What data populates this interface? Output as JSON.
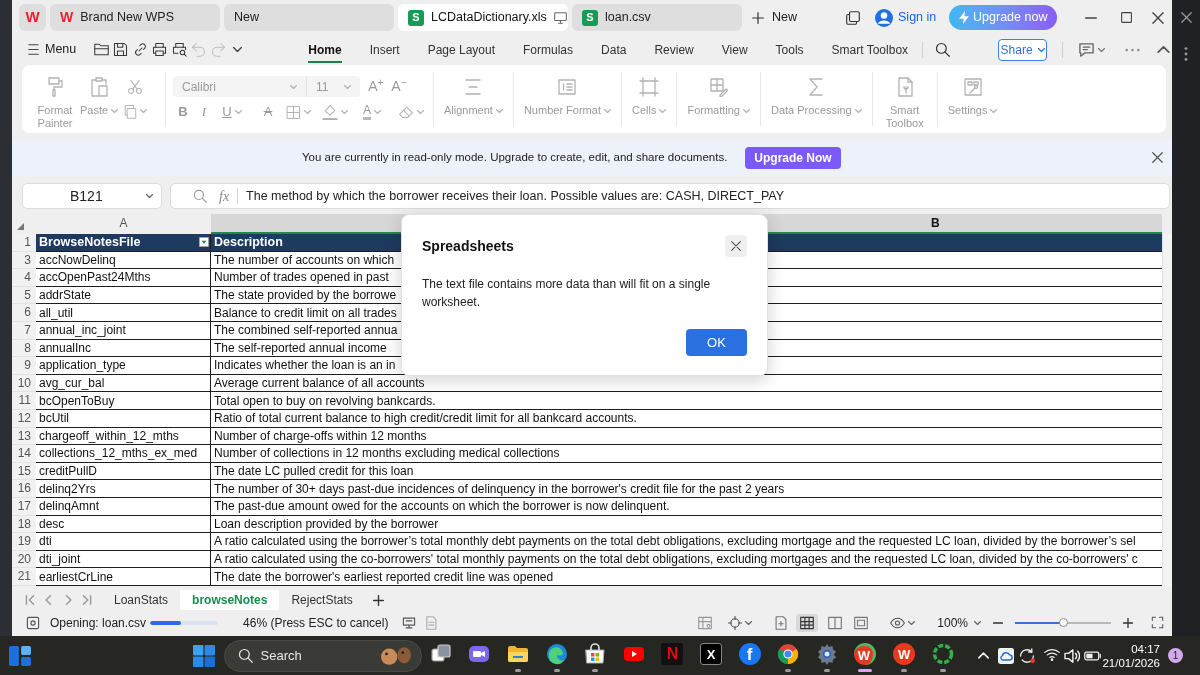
{
  "title_bar": {
    "logo": "W",
    "tabs": [
      {
        "label": "Brand New WPS",
        "kind": "home",
        "icon": "W",
        "selected": false
      },
      {
        "label": "New",
        "kind": "blank",
        "selected": false
      },
      {
        "label": "LCDataDictionary.xls",
        "kind": "sheet",
        "icon": "S",
        "selected": true
      },
      {
        "label": "loan.csv",
        "kind": "sheet",
        "icon": "S",
        "selected": false
      }
    ],
    "new_tab": "New",
    "sign_in": "Sign in",
    "upgrade": "Upgrade now"
  },
  "menu_bar": {
    "menu": "Menu",
    "history_disabled": true,
    "tabs": [
      {
        "label": "Home",
        "selected": true
      },
      {
        "label": "Insert",
        "selected": false
      },
      {
        "label": "Page Layout",
        "selected": false
      },
      {
        "label": "Formulas",
        "selected": false
      },
      {
        "label": "Data",
        "selected": false
      },
      {
        "label": "Review",
        "selected": false
      },
      {
        "label": "View",
        "selected": false
      },
      {
        "label": "Tools",
        "selected": false
      },
      {
        "label": "Smart Toolbox",
        "selected": false
      }
    ],
    "share": "Share"
  },
  "ribbon": {
    "disabled": true,
    "clipboard": [
      {
        "label": "Format Painter",
        "dropdown": false
      },
      {
        "label": "Paste",
        "dropdown": true
      }
    ],
    "font": {
      "name": "Calibri",
      "size": "11",
      "grow": "A$^{+}$",
      "shrink": "A$^{−}$",
      "styles": [
        {
          "kind": "bold",
          "glyph": "B",
          "dropdown": false
        },
        {
          "kind": "italic",
          "glyph": "I",
          "dropdown": false
        },
        {
          "kind": "underline",
          "glyph": "U",
          "dropdown": true
        },
        {
          "kind": "strike",
          "glyph": "A",
          "dropdown": false
        },
        {
          "kind": "borders",
          "dropdown": true
        },
        {
          "kind": "fill",
          "dropdown": true
        },
        {
          "kind": "color",
          "glyph": "A",
          "dropdown": true
        },
        {
          "kind": "eraser",
          "dropdown": true
        }
      ]
    },
    "groups": [
      {
        "kind": "alignment",
        "label": "Alignment",
        "dropdown": true
      },
      {
        "kind": "number",
        "label": "Number Format",
        "dropdown": true
      },
      {
        "kind": "cells",
        "label": "Cells",
        "dropdown": true
      },
      {
        "kind": "formatting",
        "label": "Formatting",
        "dropdown": true
      },
      {
        "kind": "data",
        "label": "Data Processing",
        "dropdown": true
      },
      {
        "kind": "toolbox",
        "label": "Smart Toolbox",
        "dropdown": false
      },
      {
        "kind": "settings",
        "label": "Settings",
        "dropdown": true
      }
    ]
  },
  "notice": {
    "text": "You are currently in read-only mode. Upgrade to create, edit, and share documents.",
    "button": "Upgrade Now"
  },
  "formula_bar": {
    "cell": "B121",
    "fx": "fx",
    "formula": "The method by which the borrower receives their loan. Possible values are: CASH, DIRECT_PAY"
  },
  "sheet": {
    "columns": [
      {
        "label": "A",
        "selected": false
      },
      {
        "label": "B",
        "selected": true
      }
    ],
    "rows": [
      {
        "number": "1",
        "kind": "header",
        "cells": [
          "BrowseNotesFile",
          "Description"
        ]
      },
      {
        "number": "3",
        "kind": "data",
        "cells": [
          "accNowDelinq",
          "The number of accounts on which"
        ]
      },
      {
        "number": "4",
        "kind": "data",
        "cells": [
          "accOpenPast24Mths",
          "Number of trades opened in past"
        ]
      },
      {
        "number": "5",
        "kind": "data",
        "cells": [
          "addrState",
          "The state provided by the borrowe"
        ]
      },
      {
        "number": "6",
        "kind": "data",
        "cells": [
          "all_util",
          "Balance to credit limit on all trades"
        ]
      },
      {
        "number": "7",
        "kind": "data",
        "cells": [
          "annual_inc_joint",
          "The combined self-reported annua"
        ]
      },
      {
        "number": "8",
        "kind": "data",
        "cells": [
          "annualInc",
          "The self-reported annual income"
        ]
      },
      {
        "number": "9",
        "kind": "data",
        "cells": [
          "application_type",
          "Indicates whether the loan is an in"
        ]
      },
      {
        "number": "10",
        "kind": "data",
        "cells": [
          "avg_cur_bal",
          "Average current balance of all accounts"
        ]
      },
      {
        "number": "11",
        "kind": "data",
        "cells": [
          "bcOpenToBuy",
          "Total open to buy on revolving bankcards."
        ]
      },
      {
        "number": "12",
        "kind": "data",
        "cells": [
          "bcUtil",
          "Ratio of total current balance to high credit/credit limit for all bankcard accounts."
        ]
      },
      {
        "number": "13",
        "kind": "data",
        "cells": [
          "chargeoff_within_12_mths",
          "Number of charge-offs within 12 months"
        ]
      },
      {
        "number": "14",
        "kind": "data",
        "cells": [
          "collections_12_mths_ex_med",
          "Number of collections in 12 months excluding medical collections"
        ]
      },
      {
        "number": "15",
        "kind": "data",
        "cells": [
          "creditPullD",
          "The date LC pulled credit for this loan"
        ]
      },
      {
        "number": "16",
        "kind": "data",
        "cells": [
          "delinq2Yrs",
          "The number of 30+ days past-due incidences of delinquency in the borrower's credit file for the past 2 years"
        ]
      },
      {
        "number": "17",
        "kind": "data",
        "cells": [
          "delinqAmnt",
          "The past-due amount owed for the accounts on which the borrower is now delinquent."
        ]
      },
      {
        "number": "18",
        "kind": "data",
        "cells": [
          "desc",
          "Loan description provided by the borrower"
        ]
      },
      {
        "number": "19",
        "kind": "data",
        "cells": [
          "dti",
          "A ratio calculated using the borrower’s total monthly debt payments on the total debt obligations, excluding mortgage and the requested LC loan, divided by the borrower’s sel"
        ]
      },
      {
        "number": "20",
        "kind": "data",
        "cells": [
          "dti_joint",
          "A ratio calculated using the co-borrowers' total monthly payments on the total debt obligations, excluding mortgages and the requested LC loan, divided by the co-borrowers' c"
        ]
      },
      {
        "number": "21",
        "kind": "data",
        "cells": [
          "earliestCrLine",
          "The date the borrower's earliest reported credit line was opened"
        ]
      }
    ]
  },
  "dialog": {
    "title": "Spreadsheets",
    "message": "The text file contains more data than will fit on a single worksheet.",
    "button": "OK"
  },
  "sheet_tabs": [
    {
      "label": "LoanStats",
      "selected": false
    },
    {
      "label": "browseNotes",
      "selected": true
    },
    {
      "label": "RejectStats",
      "selected": false
    }
  ],
  "status_bar": {
    "message": "Opening: loan.csv",
    "progress": {
      "level": 0.46
    },
    "progress_text": "46% (Press ESC to cancel)",
    "views": [
      {
        "kind": "reading",
        "selected": false
      },
      {
        "kind": "normal",
        "selected": true
      },
      {
        "kind": "split",
        "selected": false
      },
      {
        "kind": "page",
        "selected": false
      }
    ],
    "zoom": "100%",
    "zoom_slider": {
      "level": 0.5
    }
  },
  "taskbar": {
    "placeholder": "Search",
    "apps": [
      {
        "kind": "taskview",
        "open": false,
        "selected": false
      },
      {
        "kind": "videocall",
        "open": false,
        "selected": false
      },
      {
        "kind": "folder",
        "open": true,
        "selected": false
      },
      {
        "kind": "swirl",
        "open": true,
        "selected": false
      },
      {
        "kind": "store",
        "open": true,
        "selected": false
      },
      {
        "kind": "play",
        "open": false,
        "selected": false
      },
      {
        "kind": "ntile",
        "glyph": "N",
        "open": false,
        "selected": false
      },
      {
        "kind": "xtile",
        "glyph": "X",
        "open": false,
        "selected": false
      },
      {
        "kind": "fcircle",
        "glyph": "f",
        "open": false,
        "selected": false
      },
      {
        "kind": "sphere",
        "open": true,
        "selected": false
      },
      {
        "kind": "gear",
        "open": true,
        "selected": false
      },
      {
        "kind": "wbadge",
        "glyph": "W",
        "open": true,
        "selected": true
      },
      {
        "kind": "wtile",
        "glyph": "W",
        "open": true,
        "selected": false
      },
      {
        "kind": "ring",
        "open": true,
        "selected": false
      }
    ],
    "time": "04:17",
    "date": "21/01/2026",
    "notifications": "1"
  }
}
